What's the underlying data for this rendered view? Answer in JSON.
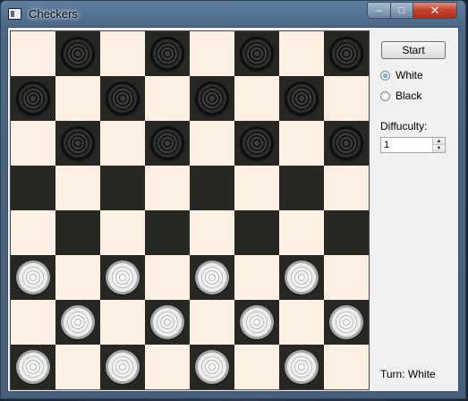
{
  "window": {
    "title": "Checkers",
    "minimize_glyph": "‒",
    "maximize_glyph": "□",
    "close_glyph": "✕"
  },
  "controls": {
    "start_label": "Start",
    "radio_options": [
      {
        "label": "White",
        "checked": true
      },
      {
        "label": "Black",
        "checked": false
      }
    ],
    "difficulty_label": "Diffuculty:",
    "difficulty_value": "1",
    "turn_text": "Turn: White"
  },
  "board": {
    "size": 8,
    "rows": [
      ".b.b.b.b",
      "b.b.b.b.",
      ".b.b.b.b",
      "........",
      "........",
      "w.w.w.w.",
      ".w.w.w.w",
      "w.w.w.w."
    ],
    "colors": {
      "light_square": "#fdefe2",
      "dark_square": "#272723"
    }
  }
}
